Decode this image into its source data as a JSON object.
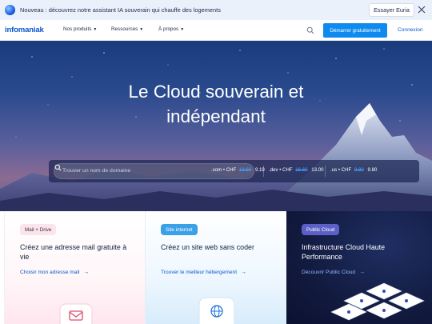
{
  "banner": {
    "text": "Nouveau : découvrez notre assistant IA souverain qui chauffe des logements",
    "button": "Essayer Euria"
  },
  "header": {
    "logo": "infomaniak",
    "nav": [
      "Nos produits",
      "Ressources",
      "À propos"
    ],
    "start_button": "Démarrer gratuitement",
    "login": "Connexion"
  },
  "hero": {
    "title_line1": "Le Cloud souverain et",
    "title_line2": "indépendant",
    "search_placeholder": "Trouver un nom de domaine",
    "prices": [
      {
        "ext": ".com",
        "label": "• CHF",
        "old": "13.60",
        "new": "9.19"
      },
      {
        "ext": ".dev",
        "label": "• CHF",
        "old": "16.60",
        "new": "13.00"
      },
      {
        "ext": ".us",
        "label": "• CHF",
        "old": "9.80",
        "new": "9.80"
      }
    ]
  },
  "cards": [
    {
      "tag": "Mail + Drive",
      "title": "Créez une adresse mail gratuite à vie",
      "link": "Choisir mon adresse mail"
    },
    {
      "tag": "Site internet",
      "title": "Créez un site web sans coder",
      "link": "Trouver le meilleur hébergement"
    },
    {
      "tag": "Public Cloud",
      "title": "Infrastructure Cloud Haute Performance",
      "link": "Découvrir Public Cloud"
    }
  ],
  "colors": {
    "accent": "#0f8bf0",
    "brand": "#0b57d0",
    "dark_card": "#121a3f"
  }
}
